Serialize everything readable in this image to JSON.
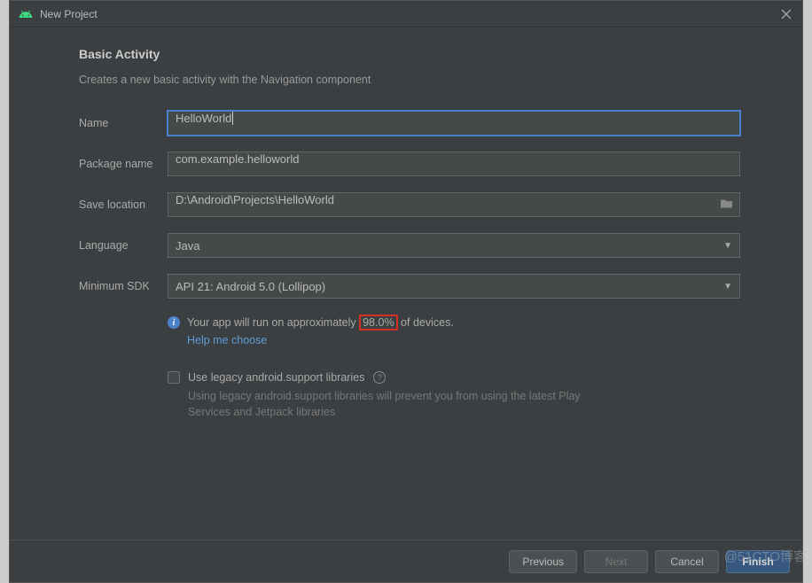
{
  "dialog": {
    "title": "New Project"
  },
  "page": {
    "heading": "Basic Activity",
    "subheading": "Creates a new basic activity with the Navigation component"
  },
  "form": {
    "name_label": "Name",
    "name_value": "HelloWorld",
    "package_label": "Package name",
    "package_value": "com.example.helloworld",
    "location_label": "Save location",
    "location_value": "D:\\Android\\Projects\\HelloWorld",
    "language_label": "Language",
    "language_value": "Java",
    "minsdk_label": "Minimum SDK",
    "minsdk_value": "API 21: Android 5.0 (Lollipop)"
  },
  "info": {
    "text_before": "Your app will run on approximately",
    "percent": "98.0%",
    "text_after": "of devices.",
    "help_link": "Help me choose"
  },
  "legacy": {
    "checkbox_label": "Use legacy android.support libraries",
    "help_text": "Using legacy android.support libraries will prevent you from using the latest Play Services and Jetpack libraries"
  },
  "buttons": {
    "previous": "Previous",
    "next": "Next",
    "cancel": "Cancel",
    "finish": "Finish"
  },
  "watermark": "@51CTO博客"
}
